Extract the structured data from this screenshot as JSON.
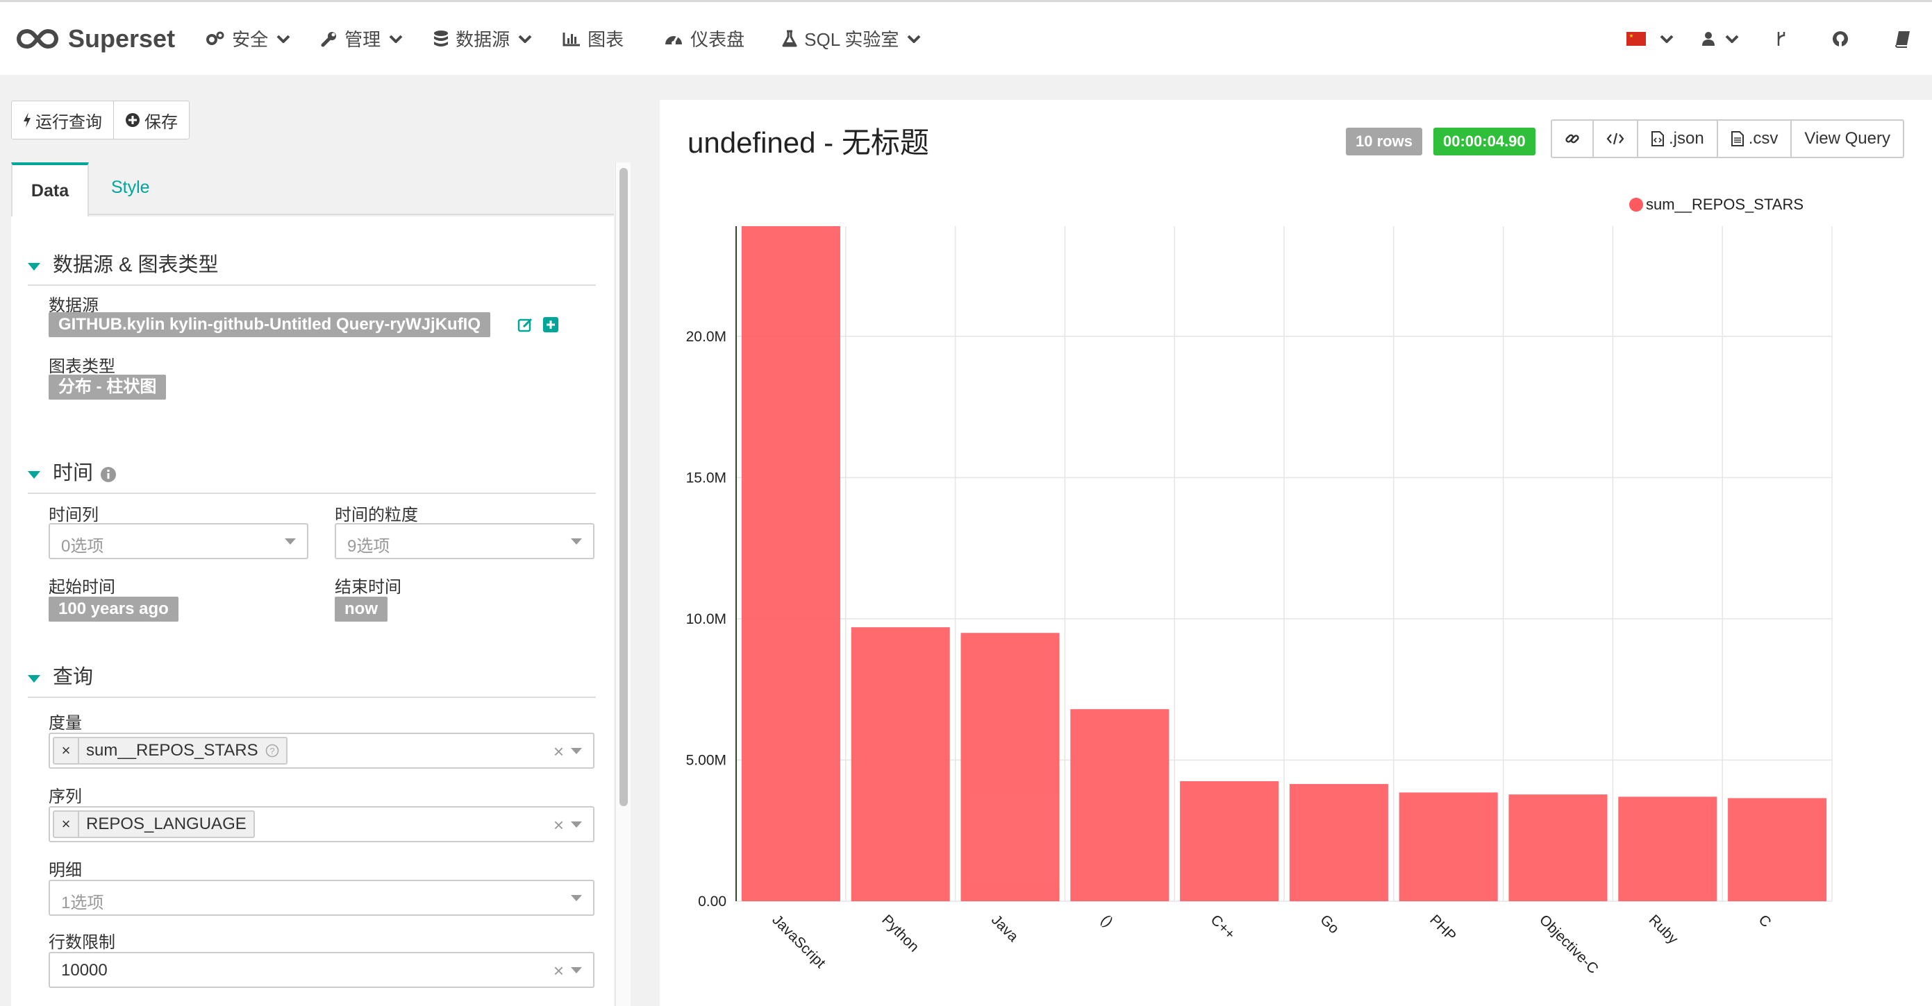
{
  "navbar": {
    "brand": "Superset",
    "menu": [
      {
        "label": "安全",
        "icon": "cogs-icon",
        "dropdown": true
      },
      {
        "label": "管理",
        "icon": "wrench-icon",
        "dropdown": true
      },
      {
        "label": "数据源",
        "icon": "database-icon",
        "dropdown": true
      },
      {
        "label": "图表",
        "icon": "bar-chart-icon",
        "dropdown": false
      },
      {
        "label": "仪表盘",
        "icon": "dashboard-icon",
        "dropdown": false
      },
      {
        "label": "SQL 实验室",
        "icon": "flask-icon",
        "dropdown": true
      }
    ],
    "right_icons": [
      "flag-cn-icon",
      "user-icon",
      "git-branch-icon",
      "github-icon",
      "book-icon"
    ]
  },
  "actions": {
    "run_query": "运行查询",
    "save": "保存"
  },
  "tabs": {
    "data": "Data",
    "style": "Style"
  },
  "sections": {
    "datasource": {
      "title": "数据源 & 图表类型",
      "datasource_label": "数据源",
      "datasource_value": "GITHUB.kylin kylin-github-Untitled Query-ryWJjKufIQ",
      "viz_label": "图表类型",
      "viz_value": "分布 - 柱状图"
    },
    "time": {
      "title": "时间",
      "time_column_label": "时间列",
      "time_column_placeholder": "0选项",
      "granularity_label": "时间的粒度",
      "granularity_placeholder": "9选项",
      "since_label": "起始时间",
      "since_value": "100 years ago",
      "until_label": "结束时间",
      "until_value": "now"
    },
    "query": {
      "title": "查询",
      "metrics_label": "度量",
      "metrics_value": "sum__REPOS_STARS",
      "groupby_label": "序列",
      "groupby_value": "REPOS_LANGUAGE",
      "columns_label": "明细",
      "columns_placeholder": "1选项",
      "row_limit_label": "行数限制",
      "row_limit_value": "10000"
    }
  },
  "chart_header": {
    "title": "undefined - 无标题",
    "rows_badge": "10 rows",
    "time_badge": "00:00:04.90",
    "json_label": ".json",
    "csv_label": ".csv",
    "view_query_label": "View Query"
  },
  "colors": {
    "accent": "#00a699",
    "bar": "#ff5a5f",
    "badge_grey": "#a6a6a6",
    "badge_green": "#2fbf3a"
  },
  "chart_data": {
    "type": "bar",
    "categories": [
      "JavaScript",
      "Python",
      "Java",
      "()",
      "C++",
      "Go",
      "PHP",
      "Objective-C",
      "Ruby",
      "C"
    ],
    "series": [
      {
        "name": "sum__REPOS_STARS",
        "values": [
          23900000,
          9700000,
          9500000,
          6800000,
          4250000,
          4150000,
          3850000,
          3780000,
          3700000,
          3650000
        ]
      }
    ],
    "ylim": [
      0,
      23900000
    ],
    "yticks": [
      0,
      5000000,
      10000000,
      15000000,
      20000000
    ],
    "ytick_labels": [
      "0.00",
      "5.00M",
      "10.0M",
      "15.0M",
      "20.0M"
    ],
    "legend": "top-right",
    "grid": true
  }
}
